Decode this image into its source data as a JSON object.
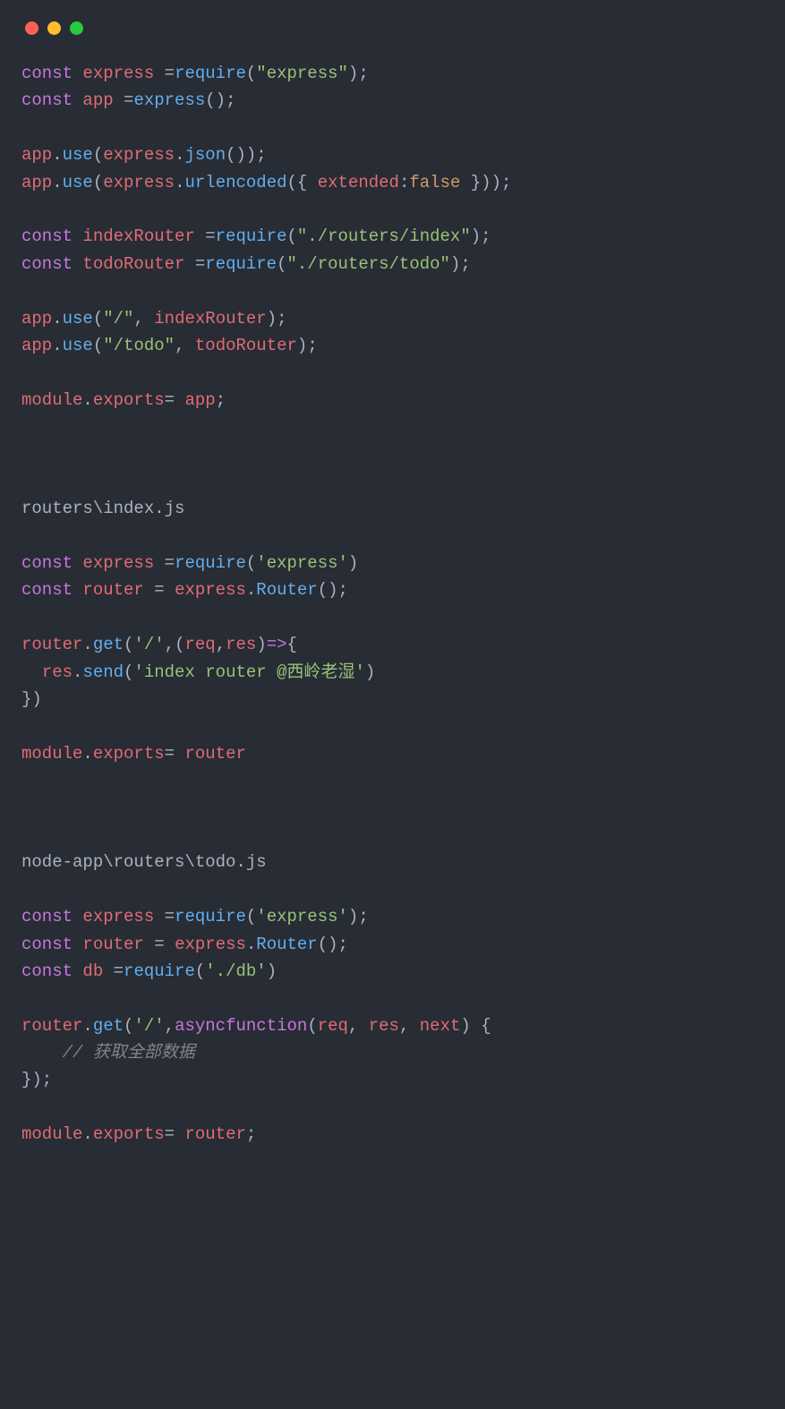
{
  "tokens": [
    [
      {
        "c": "kw",
        "t": "const"
      },
      {
        "c": "pun",
        "t": " "
      },
      {
        "c": "id",
        "t": "express"
      },
      {
        "c": "pun",
        "t": " ="
      },
      {
        "c": "fn",
        "t": "require"
      },
      {
        "c": "pun",
        "t": "("
      },
      {
        "c": "str",
        "t": "\"express\""
      },
      {
        "c": "pun",
        "t": ");"
      }
    ],
    [
      {
        "c": "kw",
        "t": "const"
      },
      {
        "c": "pun",
        "t": " "
      },
      {
        "c": "id",
        "t": "app"
      },
      {
        "c": "pun",
        "t": " ="
      },
      {
        "c": "fn",
        "t": "express"
      },
      {
        "c": "pun",
        "t": "();"
      }
    ],
    [],
    [
      {
        "c": "id",
        "t": "app"
      },
      {
        "c": "pun",
        "t": "."
      },
      {
        "c": "fn",
        "t": "use"
      },
      {
        "c": "pun",
        "t": "("
      },
      {
        "c": "id",
        "t": "express"
      },
      {
        "c": "pun",
        "t": "."
      },
      {
        "c": "fn",
        "t": "json"
      },
      {
        "c": "pun",
        "t": "());"
      }
    ],
    [
      {
        "c": "id",
        "t": "app"
      },
      {
        "c": "pun",
        "t": "."
      },
      {
        "c": "fn",
        "t": "use"
      },
      {
        "c": "pun",
        "t": "("
      },
      {
        "c": "id",
        "t": "express"
      },
      {
        "c": "pun",
        "t": "."
      },
      {
        "c": "fn",
        "t": "urlencoded"
      },
      {
        "c": "pun",
        "t": "({ "
      },
      {
        "c": "id",
        "t": "extended"
      },
      {
        "c": "pun",
        "t": ":"
      },
      {
        "c": "num",
        "t": "false"
      },
      {
        "c": "pun",
        "t": " }));"
      }
    ],
    [],
    [
      {
        "c": "kw",
        "t": "const"
      },
      {
        "c": "pun",
        "t": " "
      },
      {
        "c": "id",
        "t": "indexRouter"
      },
      {
        "c": "pun",
        "t": " ="
      },
      {
        "c": "fn",
        "t": "require"
      },
      {
        "c": "pun",
        "t": "("
      },
      {
        "c": "str",
        "t": "\"./routers/index\""
      },
      {
        "c": "pun",
        "t": ");"
      }
    ],
    [
      {
        "c": "kw",
        "t": "const"
      },
      {
        "c": "pun",
        "t": " "
      },
      {
        "c": "id",
        "t": "todoRouter"
      },
      {
        "c": "pun",
        "t": " ="
      },
      {
        "c": "fn",
        "t": "require"
      },
      {
        "c": "pun",
        "t": "("
      },
      {
        "c": "str",
        "t": "\"./routers/todo\""
      },
      {
        "c": "pun",
        "t": ");"
      }
    ],
    [],
    [
      {
        "c": "id",
        "t": "app"
      },
      {
        "c": "pun",
        "t": "."
      },
      {
        "c": "fn",
        "t": "use"
      },
      {
        "c": "pun",
        "t": "("
      },
      {
        "c": "str",
        "t": "\"/\""
      },
      {
        "c": "pun",
        "t": ", "
      },
      {
        "c": "id",
        "t": "indexRouter"
      },
      {
        "c": "pun",
        "t": ");"
      }
    ],
    [
      {
        "c": "id",
        "t": "app"
      },
      {
        "c": "pun",
        "t": "."
      },
      {
        "c": "fn",
        "t": "use"
      },
      {
        "c": "pun",
        "t": "("
      },
      {
        "c": "str",
        "t": "\"/todo\""
      },
      {
        "c": "pun",
        "t": ", "
      },
      {
        "c": "id",
        "t": "todoRouter"
      },
      {
        "c": "pun",
        "t": ");"
      }
    ],
    [],
    [
      {
        "c": "id",
        "t": "module"
      },
      {
        "c": "pun",
        "t": "."
      },
      {
        "c": "prop",
        "t": "exports"
      },
      {
        "c": "pun",
        "t": "= "
      },
      {
        "c": "id",
        "t": "app"
      },
      {
        "c": "pun",
        "t": ";"
      }
    ],
    [],
    [],
    [],
    [
      {
        "c": "path",
        "t": "routers\\index.js"
      }
    ],
    [],
    [
      {
        "c": "kw",
        "t": "const"
      },
      {
        "c": "pun",
        "t": " "
      },
      {
        "c": "id",
        "t": "express"
      },
      {
        "c": "pun",
        "t": " ="
      },
      {
        "c": "fn",
        "t": "require"
      },
      {
        "c": "pun",
        "t": "("
      },
      {
        "c": "str",
        "t": "'express'"
      },
      {
        "c": "pun",
        "t": ")"
      }
    ],
    [
      {
        "c": "kw",
        "t": "const"
      },
      {
        "c": "pun",
        "t": " "
      },
      {
        "c": "id",
        "t": "router"
      },
      {
        "c": "pun",
        "t": " = "
      },
      {
        "c": "id",
        "t": "express"
      },
      {
        "c": "pun",
        "t": "."
      },
      {
        "c": "fn",
        "t": "Router"
      },
      {
        "c": "pun",
        "t": "();"
      }
    ],
    [],
    [
      {
        "c": "id",
        "t": "router"
      },
      {
        "c": "pun",
        "t": "."
      },
      {
        "c": "fn",
        "t": "get"
      },
      {
        "c": "pun",
        "t": "("
      },
      {
        "c": "str",
        "t": "'/'"
      },
      {
        "c": "pun",
        "t": ",("
      },
      {
        "c": "id",
        "t": "req"
      },
      {
        "c": "pun",
        "t": ","
      },
      {
        "c": "id",
        "t": "res"
      },
      {
        "c": "pun",
        "t": ")"
      },
      {
        "c": "kw",
        "t": "=>"
      },
      {
        "c": "pun",
        "t": "{"
      }
    ],
    [
      {
        "c": "pun",
        "t": "  "
      },
      {
        "c": "id",
        "t": "res"
      },
      {
        "c": "pun",
        "t": "."
      },
      {
        "c": "fn",
        "t": "send"
      },
      {
        "c": "pun",
        "t": "("
      },
      {
        "c": "str",
        "t": "'index router @西岭老湿'"
      },
      {
        "c": "pun",
        "t": ")"
      }
    ],
    [
      {
        "c": "pun",
        "t": "})"
      }
    ],
    [],
    [
      {
        "c": "id",
        "t": "module"
      },
      {
        "c": "pun",
        "t": "."
      },
      {
        "c": "prop",
        "t": "exports"
      },
      {
        "c": "pun",
        "t": "= "
      },
      {
        "c": "id",
        "t": "router"
      }
    ],
    [],
    [],
    [],
    [
      {
        "c": "path",
        "t": "node-app\\routers\\todo.js"
      }
    ],
    [],
    [
      {
        "c": "kw",
        "t": "const"
      },
      {
        "c": "pun",
        "t": " "
      },
      {
        "c": "id",
        "t": "express"
      },
      {
        "c": "pun",
        "t": " ="
      },
      {
        "c": "fn",
        "t": "require"
      },
      {
        "c": "pun",
        "t": "("
      },
      {
        "c": "str",
        "t": "'express'"
      },
      {
        "c": "pun",
        "t": ");"
      }
    ],
    [
      {
        "c": "kw",
        "t": "const"
      },
      {
        "c": "pun",
        "t": " "
      },
      {
        "c": "id",
        "t": "router"
      },
      {
        "c": "pun",
        "t": " = "
      },
      {
        "c": "id",
        "t": "express"
      },
      {
        "c": "pun",
        "t": "."
      },
      {
        "c": "fn",
        "t": "Router"
      },
      {
        "c": "pun",
        "t": "();"
      }
    ],
    [
      {
        "c": "kw",
        "t": "const"
      },
      {
        "c": "pun",
        "t": " "
      },
      {
        "c": "id",
        "t": "db"
      },
      {
        "c": "pun",
        "t": " ="
      },
      {
        "c": "fn",
        "t": "require"
      },
      {
        "c": "pun",
        "t": "("
      },
      {
        "c": "str",
        "t": "'./db'"
      },
      {
        "c": "pun",
        "t": ")"
      }
    ],
    [],
    [
      {
        "c": "id",
        "t": "router"
      },
      {
        "c": "pun",
        "t": "."
      },
      {
        "c": "fn",
        "t": "get"
      },
      {
        "c": "pun",
        "t": "("
      },
      {
        "c": "str",
        "t": "'/'"
      },
      {
        "c": "pun",
        "t": ","
      },
      {
        "c": "kw",
        "t": "async"
      },
      {
        "c": "kw",
        "t": "function"
      },
      {
        "c": "pun",
        "t": "("
      },
      {
        "c": "id",
        "t": "req"
      },
      {
        "c": "pun",
        "t": ", "
      },
      {
        "c": "id",
        "t": "res"
      },
      {
        "c": "pun",
        "t": ", "
      },
      {
        "c": "id",
        "t": "next"
      },
      {
        "c": "pun",
        "t": ") {"
      }
    ],
    [
      {
        "c": "pun",
        "t": "    "
      },
      {
        "c": "cmt",
        "t": "// 获取全部数据"
      }
    ],
    [
      {
        "c": "pun",
        "t": "});"
      }
    ],
    [],
    [
      {
        "c": "id",
        "t": "module"
      },
      {
        "c": "pun",
        "t": "."
      },
      {
        "c": "prop",
        "t": "exports"
      },
      {
        "c": "pun",
        "t": "= "
      },
      {
        "c": "id",
        "t": "router"
      },
      {
        "c": "pun",
        "t": ";"
      }
    ]
  ]
}
